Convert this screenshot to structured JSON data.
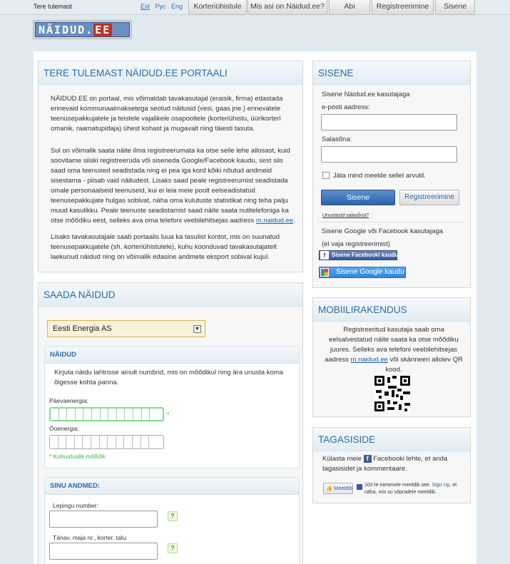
{
  "topbar": {
    "welcome": "Tere tulemast",
    "languages": [
      "Est",
      "Рус",
      "Eng"
    ],
    "nav": [
      "Korteriühistule",
      "Mis asi on Näidud.ee?",
      "Abi",
      "Registreerimine",
      "Sisene"
    ]
  },
  "logo": {
    "text": "NÄIDUD.",
    "ee": "EE"
  },
  "welcome_panel": {
    "title": "TERE TULEMAST NÄIDUD.EE PORTAALI",
    "p1": "NÄIDUD.EE on portaal, mis võimaldab tavakasutajal (eraisik, firma) edastada erinevaid kommunaalmaksetega seotud näitusid (vesi, gaas jne.) erinevatele teenusepakkujatele ja teistele vajalikele osapooltele (korteriühistu, üürikorteri omanik, raamatupidaja) ühest kohast ja mugavalt ning täiesti tasuta.",
    "p2": "Sul on võimalik saata näite ilma registreerumata ka otse selle lehe allosast, kuid soovitame siiski registreeruda või siseneda Google/Facebook kaudu, sest siis saad oma teenused seadistada ning ei pea iga kord kõiki nõutud andmeid sisestama - piisab vaid näitudest. Lisaks saad peale registreerumist seadistada omale personaalseid teenuseid, kui ei leia meie poolt eelseadistatud teenusepakkujate hulgas sobivat, näha oma kulutuste statistikat ning teha palju muud kasulikku. Peale teenuste seadistamist saad näite saata nutitelefoniga ka otse mõõdiku eest, selleks ava oma telefoni veebilehitsejas aadress",
    "p2_link": "m.naidud.ee",
    "p2_end": ".",
    "p3": "Lisaks tavakasutajale saab portaalis luua ka tasulist kontot, mis on suunatud teenusepakkujatele (sh. korteriühistutele), kuhu koonduvad tavakasutajatelt laekunud näidud ning on võimalik edasine andmete eksport sobival kujul."
  },
  "send_panel": {
    "title": "SAADA NÄIDUD",
    "provider": "Eesti Energia AS",
    "readings": {
      "title": "NÄIDUD",
      "hint": "Kirjuta näidu lahtrisse ainult numbrid, mis on mõõdikul ning ära unusta koma õigesse kohta panna.",
      "day_label": "Päevaenergia:",
      "night_label": "Öoenergia:",
      "required_mark": "*",
      "required_note": "* Kohustuslik mõõdik"
    },
    "your_data": {
      "title": "SINU ANDMED:",
      "contract_label": "Lepingu number:",
      "address_label": "Tänav, maja nr., korter, talu:",
      "help": "?"
    }
  },
  "login_panel": {
    "title": "SISENE",
    "subtitle": "Sisene Näidud.ee kasutajaga",
    "email_label": "e-posti aadress:",
    "password_label": "Salasõna:",
    "remember": "Jäta mind meelde sellel arvutil.",
    "login_button": "Sisene",
    "register_button": "Registreerimine",
    "forgot": "Unustasid salasõna?",
    "social_title": "Sisene Google või Facebook kasutajaga",
    "social_note": "(ei vaja registreerimist)",
    "facebook_button": "Sisene Facebooki kaudu",
    "google_button": "Sisene Google kaudu"
  },
  "mobile_panel": {
    "title": "MOBIILIRAKENDUS",
    "text": "Registreeritud kasutaja saab oma eelsalvestatud näite saata ka otse mõõdiku juures. Selleks ava telefoni veebilehitsejas aadress",
    "link": "m.naidud.ee",
    "text_end": "või skänneeri allolev QR kood."
  },
  "feedback_panel": {
    "title": "TAGASISIDE",
    "text_start": "Külasta meie",
    "text_end": "Facebooki lehte, et anda tagasisidet ja kommentaare.",
    "like_button": "Meeldib",
    "like_text_start": "102-le inimesele meeldib see.",
    "sign_up": "Sign Up",
    "like_text_end": ", et näha, mis su sõpradele meeldib."
  },
  "colors": {
    "accent": "#2a6ba8",
    "button_blue": "#2f63ad",
    "facebook": "#3b5998",
    "valid_green": "#7fdc8d"
  }
}
